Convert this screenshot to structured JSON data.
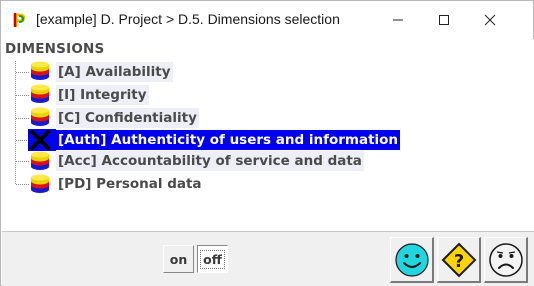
{
  "window": {
    "title": "[example] D. Project > D.5. Dimensions selection",
    "app_icon": "P",
    "app_icon_colors": [
      "#e8c400",
      "#d60000"
    ]
  },
  "tree": {
    "root_label": "DIMENSIONS",
    "items": [
      {
        "label": "[A] Availability",
        "icon": "stacked-coins-icon",
        "selected": false,
        "excluded": false
      },
      {
        "label": "[I] Integrity",
        "icon": "stacked-coins-icon",
        "selected": false,
        "excluded": false
      },
      {
        "label": "[C] Confidentiality",
        "icon": "stacked-coins-icon",
        "selected": false,
        "excluded": false
      },
      {
        "label": "[Auth] Authenticity of users and information",
        "icon": "excluded-x-icon",
        "selected": true,
        "excluded": true
      },
      {
        "label": "[Acc] Accountability of service and data",
        "icon": "stacked-coins-icon",
        "selected": false,
        "excluded": false
      },
      {
        "label": "[PD] Personal data",
        "icon": "stacked-coins-icon",
        "selected": false,
        "excluded": false
      }
    ],
    "selection_color": "#0000ee"
  },
  "toolbar": {
    "on_label": "on",
    "off_label": "off",
    "off_pressed": true,
    "buttons": [
      "smiley-happy-icon",
      "warning-question-icon",
      "smiley-sad-icon"
    ]
  }
}
